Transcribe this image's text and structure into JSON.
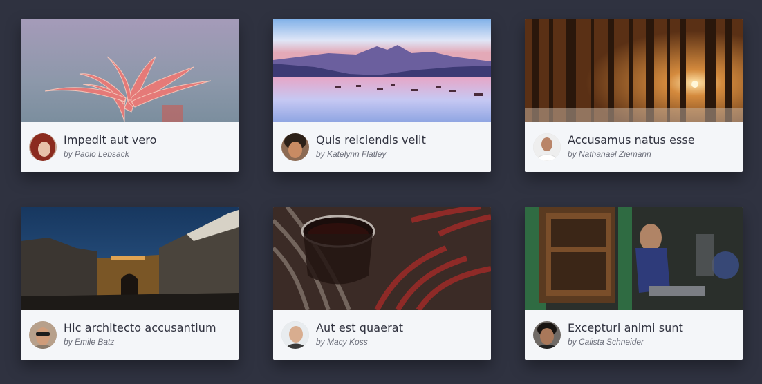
{
  "cards": [
    {
      "title": "Impedit aut vero",
      "byline": "by Paolo Lebsack",
      "image_subject": "pink lily flower",
      "avatar_subject": "woman with red hair"
    },
    {
      "title": "Quis reiciendis velit",
      "byline": "by Katelynn Flatley",
      "image_subject": "lake with boats and mountains at dusk",
      "avatar_subject": "man with curly hair"
    },
    {
      "title": "Accusamus natus esse",
      "byline": "by Nathanael Ziemann",
      "image_subject": "forest with sunlight through trees",
      "avatar_subject": "man in white shirt"
    },
    {
      "title": "Hic architecto accusantium",
      "byline": "by Emile Batz",
      "image_subject": "bridge between cliffs at night",
      "avatar_subject": "man with sunglasses"
    },
    {
      "title": "Aut est quaerat",
      "byline": "by Macy Koss",
      "image_subject": "cup of tea on knitted scarf",
      "avatar_subject": "bald man smiling"
    },
    {
      "title": "Excepturi animi sunt",
      "byline": "by Calista Schneider",
      "image_subject": "man sitting in green doorway",
      "avatar_subject": "young man dark hair"
    }
  ]
}
